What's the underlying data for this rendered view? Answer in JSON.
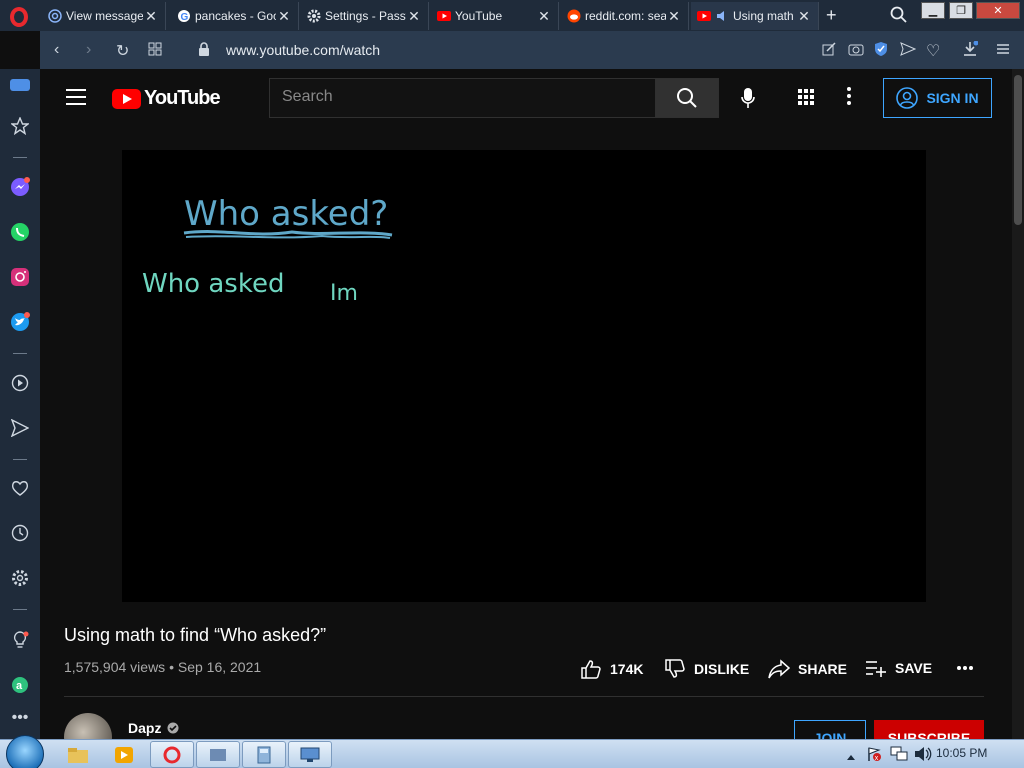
{
  "browser": {
    "tabs": [
      {
        "label": "View message",
        "icon": "at-icon"
      },
      {
        "label": "pancakes - Goo",
        "icon": "google-icon"
      },
      {
        "label": "Settings - Passw",
        "icon": "gear-icon"
      },
      {
        "label": "YouTube",
        "icon": "youtube-icon"
      },
      {
        "label": "reddit.com: sea",
        "icon": "reddit-icon"
      },
      {
        "label": "Using math",
        "icon": "youtube-icon",
        "active": true
      }
    ],
    "url": "www.youtube.com/watch",
    "new_tab": "+"
  },
  "youtube": {
    "logo_text": "YouTube",
    "search_placeholder": "Search",
    "sign_in": "SIGN IN",
    "video_text_line1": "Who asked?",
    "video_text_line2": "Who asked",
    "video_text_line3": "Im",
    "title": "Using math to find “Who asked?”",
    "views_date": "1,575,904 views • Sep 16, 2021",
    "actions": {
      "like_count": "174K",
      "dislike": "DISLIKE",
      "share": "SHARE",
      "save": "SAVE"
    },
    "channel_name": "Dapz",
    "join": "JOIN",
    "subscribe": "SUBSCRIBE"
  },
  "taskbar": {
    "clock": "10:05 PM"
  },
  "colors": {
    "accent_blue": "#3ea6ff",
    "youtube_red": "#ff0000",
    "chalk_blue": "#5fa8c9",
    "chalk_green": "#6fd6c0"
  }
}
